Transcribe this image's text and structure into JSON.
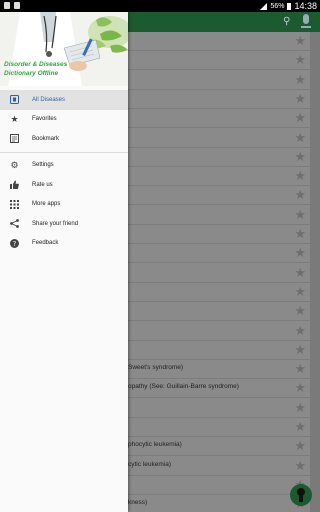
{
  "status_bar": {
    "battery": "56%",
    "time": "14:38"
  },
  "drawer": {
    "title_line1": "Disorder & Diseases",
    "title_line2": "Dictionary Offline",
    "items": [
      {
        "label": "All Diseases",
        "icon": "list-icon",
        "active": true
      },
      {
        "label": "Favorites",
        "icon": "star-icon"
      },
      {
        "label": "Bookmark",
        "icon": "bookmark-icon"
      },
      {
        "label": "Settings",
        "icon": "gear-icon"
      },
      {
        "label": "Rate us",
        "icon": "thumbs-up-icon"
      },
      {
        "label": "More apps",
        "icon": "grid-icon"
      },
      {
        "label": "Share your friend",
        "icon": "share-icon"
      },
      {
        "label": "Feedback",
        "icon": "help-icon"
      }
    ]
  },
  "background_list": {
    "visible_texts": [
      "Sweet's syndrome)",
      "opathy (See: Guillain-Barre syndrome)",
      "phocytic leukemia)",
      "cytic leukemia)",
      "kness)"
    ]
  },
  "colors": {
    "appbar": "#1c5a2f",
    "accent": "#2f5fb0",
    "title_green": "#2fa63a"
  }
}
